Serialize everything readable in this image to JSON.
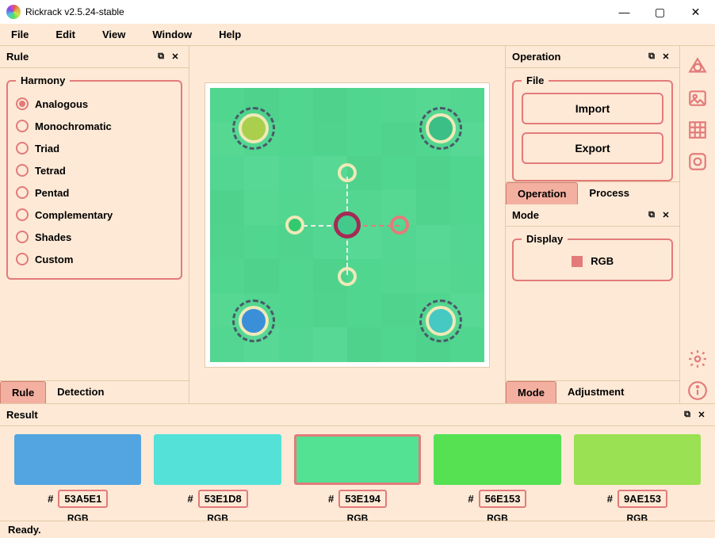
{
  "window": {
    "title": "Rickrack v2.5.24-stable"
  },
  "menu": {
    "file": "File",
    "edit": "Edit",
    "view": "View",
    "window": "Window",
    "help": "Help"
  },
  "rule": {
    "title": "Rule",
    "harmony_legend": "Harmony",
    "options": [
      {
        "label": "Analogous",
        "selected": true
      },
      {
        "label": "Monochromatic",
        "selected": false
      },
      {
        "label": "Triad",
        "selected": false
      },
      {
        "label": "Tetrad",
        "selected": false
      },
      {
        "label": "Pentad",
        "selected": false
      },
      {
        "label": "Complementary",
        "selected": false
      },
      {
        "label": "Shades",
        "selected": false
      },
      {
        "label": "Custom",
        "selected": false
      }
    ],
    "tabs": {
      "rule": "Rule",
      "detection": "Detection"
    }
  },
  "operation": {
    "title": "Operation",
    "file_legend": "File",
    "import_btn": "Import",
    "export_btn": "Export",
    "tabs": {
      "operation": "Operation",
      "process": "Process"
    }
  },
  "mode": {
    "title": "Mode",
    "display_legend": "Display",
    "rgb_label": "RGB",
    "tabs": {
      "mode": "Mode",
      "adjustment": "Adjustment"
    }
  },
  "result": {
    "title": "Result",
    "hash": "#",
    "rgb_label": "RGB",
    "swatches": [
      {
        "hex": "53A5E1",
        "color": "#53A5E1",
        "selected": false
      },
      {
        "hex": "53E1D8",
        "color": "#53E1D8",
        "selected": false
      },
      {
        "hex": "53E194",
        "color": "#53E194",
        "selected": true
      },
      {
        "hex": "56E153",
        "color": "#56E153",
        "selected": false
      },
      {
        "hex": "9AE153",
        "color": "#9AE153",
        "selected": false
      }
    ]
  },
  "status": {
    "text": "Ready."
  }
}
